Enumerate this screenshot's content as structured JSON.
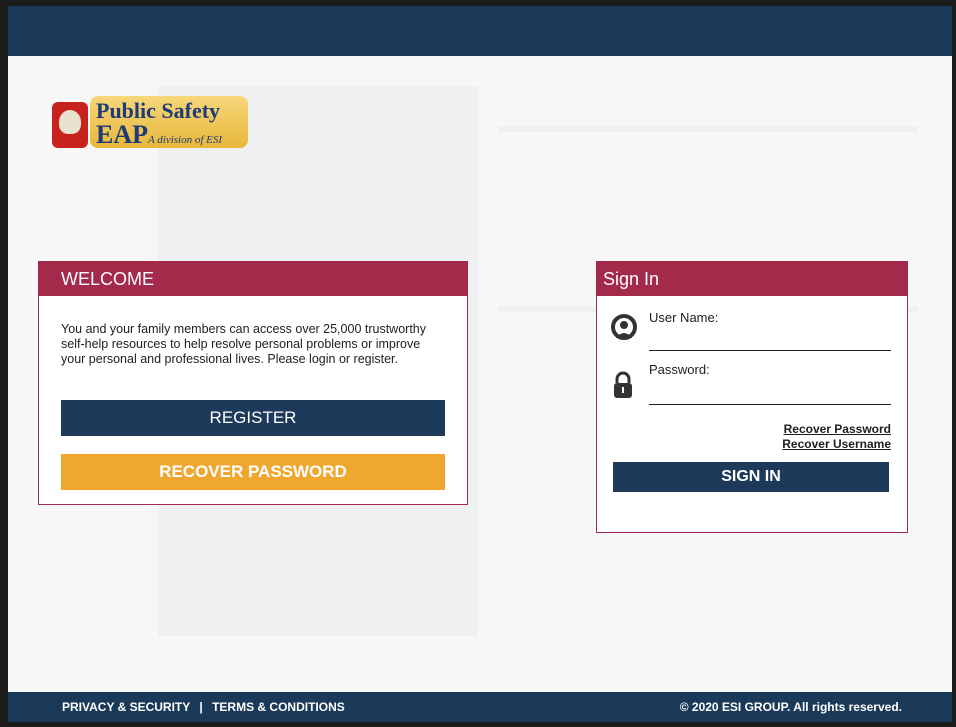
{
  "logo": {
    "line1": "Public Safety",
    "line2": "EAP",
    "tagline": "A division of ESI"
  },
  "welcome": {
    "heading": "WELCOME",
    "body": "You and your family members can access over 25,000 trustworthy self-help resources to help resolve personal problems or improve your personal and professional lives. Please login or register.",
    "register_label": "REGISTER",
    "recover_password_label": "RECOVER PASSWORD"
  },
  "signin": {
    "heading": "Sign In",
    "username_label": "User Name:",
    "username_value": "",
    "password_label": "Password:",
    "password_value": "",
    "recover_password_link": "Recover Password",
    "recover_username_link": "Recover Username",
    "signin_label": "SIGN IN"
  },
  "footer": {
    "privacy": "PRIVACY & SECURITY",
    "separator": "|",
    "terms": "TERMS & CONDITIONS",
    "copyright": "© 2020 ESI GROUP. All rights reserved."
  },
  "colors": {
    "navy": "#1b3a5a",
    "maroon": "#a32a4a",
    "orange": "#efa72f"
  },
  "icons": [
    "user-icon",
    "lock-icon"
  ]
}
